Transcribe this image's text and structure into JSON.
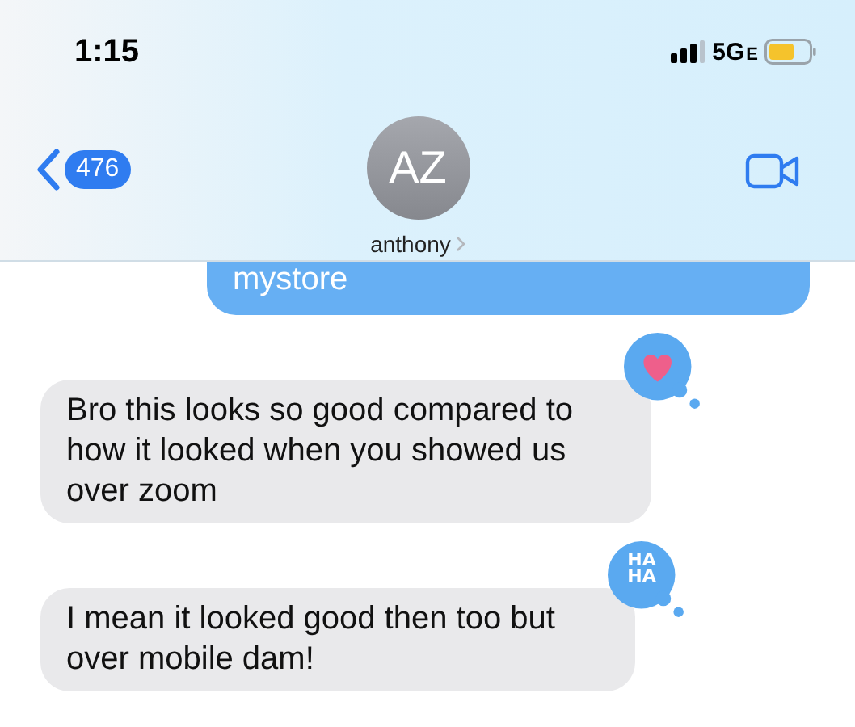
{
  "status_bar": {
    "time": "1:15",
    "network": "5G",
    "network_suffix": "E"
  },
  "nav": {
    "back_count": "476",
    "avatar_initials": "AZ",
    "contact_name": "anthony"
  },
  "messages": [
    {
      "kind": "sent",
      "text": "mystore"
    },
    {
      "kind": "received",
      "text": "Bro this looks so good compared to how it looked when you showed us over zoom",
      "reaction": {
        "kind": "heart"
      }
    },
    {
      "kind": "received",
      "text": "I mean it looked good then too but over mobile dam!",
      "reaction": {
        "kind": "haha",
        "label": "HA HA"
      }
    }
  ]
}
